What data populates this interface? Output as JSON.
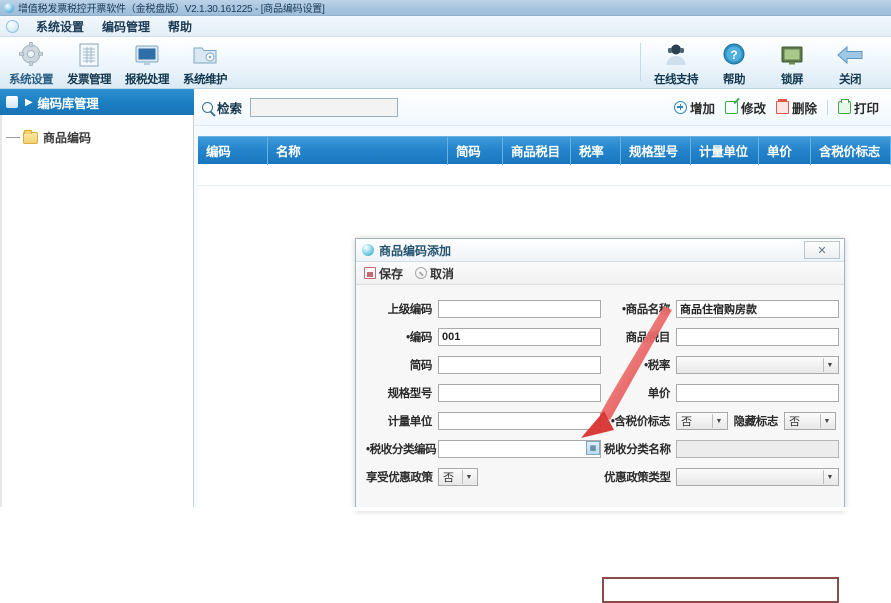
{
  "window": {
    "title": "增值税发票税控开票软件（金税盘版）V2.1.30.161225 - [商品编码设置]",
    "icon": "app-icon"
  },
  "menubar": {
    "icon": "app-round-icon",
    "items": [
      {
        "label": "系统设置"
      },
      {
        "label": "编码管理"
      },
      {
        "label": "帮助"
      }
    ]
  },
  "ribbon": {
    "left_tools": [
      {
        "label": "系统设置",
        "icon": "gear-icon"
      },
      {
        "label": "发票管理",
        "icon": "invoice-icon"
      },
      {
        "label": "报税处理",
        "icon": "monitor-icon"
      },
      {
        "label": "系统维护",
        "icon": "folder-disc-icon"
      }
    ],
    "right_tools": [
      {
        "label": "在线支持",
        "icon": "person-support-icon"
      },
      {
        "label": "帮助",
        "icon": "question-icon"
      },
      {
        "label": "锁屏",
        "icon": "screen-lock-icon"
      },
      {
        "label": "关闭",
        "icon": "back-arrow-icon"
      }
    ]
  },
  "sidebar": {
    "header": "编码库管理",
    "header_icon": "book-icon",
    "chevron": "▶",
    "tree": [
      {
        "label": "商品编码",
        "icon": "folder-icon"
      }
    ]
  },
  "main": {
    "search": {
      "label": "检索",
      "icon": "search-icon",
      "value": "",
      "placeholder": ""
    },
    "actions": [
      {
        "label": "增加",
        "icon": "plus-circle-icon"
      },
      {
        "label": "修改",
        "icon": "edit-icon"
      },
      {
        "label": "删除",
        "icon": "trash-icon"
      },
      {
        "label": "打印",
        "icon": "print-icon"
      }
    ],
    "grid": {
      "columns": [
        {
          "label": "编码",
          "width": 70
        },
        {
          "label": "名称",
          "width": 180
        },
        {
          "label": "简码",
          "width": 55
        },
        {
          "label": "商品税目",
          "width": 68
        },
        {
          "label": "税率",
          "width": 50
        },
        {
          "label": "规格型号",
          "width": 70
        },
        {
          "label": "计量单位",
          "width": 68
        },
        {
          "label": "单价",
          "width": 52
        },
        {
          "label": "含税价标志",
          "width": 80
        }
      ],
      "rows": []
    }
  },
  "dialog": {
    "title": "商品编码添加",
    "title_icon": "dialog-icon",
    "close_label": "✕",
    "toolbar": [
      {
        "label": "保存",
        "icon": "save-icon"
      },
      {
        "label": "取消",
        "icon": "cancel-icon"
      }
    ],
    "left_fields": [
      {
        "label": "上级编码",
        "required": false,
        "type": "text",
        "value": ""
      },
      {
        "label": "编码",
        "required": true,
        "type": "text",
        "value": "001"
      },
      {
        "label": "简码",
        "required": false,
        "type": "text",
        "value": ""
      },
      {
        "label": "规格型号",
        "required": false,
        "type": "text",
        "value": ""
      },
      {
        "label": "计量单位",
        "required": false,
        "type": "text",
        "value": ""
      },
      {
        "label": "税收分类编码",
        "required": true,
        "type": "browse",
        "value": ""
      }
    ],
    "left_bottom": {
      "label": "享受优惠政策",
      "type": "select",
      "value": "否"
    },
    "right_fields": [
      {
        "label": "商品名称",
        "required": true,
        "type": "text",
        "value": "商品住宿购房款",
        "highlight": true
      },
      {
        "label": "商品税目",
        "required": false,
        "type": "text",
        "value": ""
      },
      {
        "label": "税率",
        "required": true,
        "type": "select",
        "value": ""
      },
      {
        "label": "单价",
        "required": false,
        "type": "text",
        "value": ""
      }
    ],
    "flags_row": [
      {
        "label": "含税价标志",
        "required": true,
        "value": "否"
      },
      {
        "label": "隐藏标志",
        "required": false,
        "value": "否"
      }
    ],
    "right_bottom": [
      {
        "label": "税收分类名称",
        "type": "text",
        "value": ""
      },
      {
        "label": "优惠政策类型",
        "type": "select",
        "value": ""
      }
    ]
  },
  "annotation": {
    "arrow": "red-arrow-annotation",
    "color": "#e03a3a"
  },
  "colors": {
    "title_bar": "#a8c6e0",
    "ribbon_accent": "#2484cb",
    "sidebar_header": "#1b7ec2",
    "grid_header": "#2484cb",
    "highlight_border": "#8a4b4b",
    "annotation_red": "#e03a3a"
  }
}
